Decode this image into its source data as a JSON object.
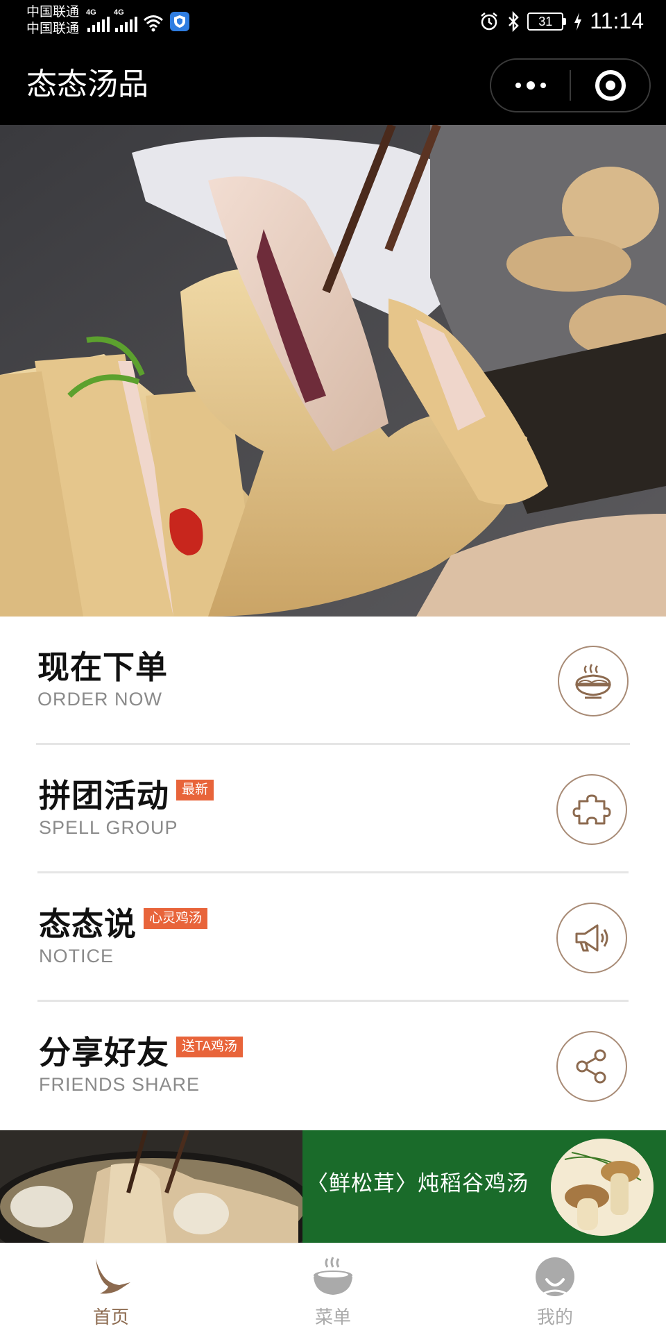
{
  "status_bar": {
    "carrier_1": "中国联通",
    "carrier_2": "中国联通",
    "network_1": "4G",
    "network_2": "4G",
    "battery": "31",
    "time": "11:14"
  },
  "title_bar": {
    "title": "态态汤品",
    "more_icon": "more-dots-icon",
    "close_icon": "target-close-icon"
  },
  "menu": {
    "items": [
      {
        "title": "现在下单",
        "subtitle": "ORDER NOW",
        "badge": "",
        "icon": "noodle-bowl-icon"
      },
      {
        "title": "拼团活动",
        "subtitle": "SPELL GROUP",
        "badge": "最新",
        "icon": "puzzle-icon"
      },
      {
        "title": "态态说",
        "subtitle": "NOTICE",
        "badge": "心灵鸡汤",
        "icon": "megaphone-icon"
      },
      {
        "title": "分享好友",
        "subtitle": "FRIENDS SHARE",
        "badge": "送TA鸡汤",
        "icon": "share-icon"
      }
    ]
  },
  "banner": {
    "text": "〈鲜松茸〉炖稻谷鸡汤"
  },
  "tab_bar": {
    "tabs": [
      {
        "label": "首页",
        "icon": "crane-icon",
        "active": true
      },
      {
        "label": "菜单",
        "icon": "soup-bowl-icon",
        "active": false
      },
      {
        "label": "我的",
        "icon": "user-avatar-icon",
        "active": false
      }
    ],
    "active_color": "#8c6a4f",
    "inactive_color": "#aaaaaa"
  },
  "colors": {
    "accent_brown": "#a88b76",
    "badge_orange": "#e8643a",
    "banner_green": "#1a6b2a"
  }
}
